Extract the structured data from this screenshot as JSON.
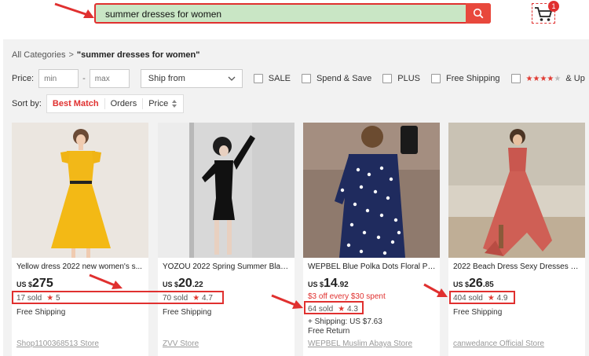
{
  "search": {
    "query": "summer dresses for women"
  },
  "cart": {
    "count": "1"
  },
  "breadcrumb": {
    "root": "All Categories",
    "separator": ">",
    "query": "\"summer dresses for women\""
  },
  "filters": {
    "price_label": "Price:",
    "min_placeholder": "min",
    "max_placeholder": "max",
    "dash": "-",
    "ship_from": "Ship from",
    "checkboxes": [
      "SALE",
      "Spend & Save",
      "PLUS",
      "Free Shipping"
    ],
    "rating_up": "& Up"
  },
  "sort": {
    "label": "Sort by:",
    "options": [
      "Best Match",
      "Orders",
      "Price"
    ]
  },
  "products": [
    {
      "title": "Yellow dress 2022 new women's s...",
      "currency": "US $",
      "price_whole": "275",
      "price_cents": "",
      "sold": "17 sold",
      "rating": "5",
      "shipping": "Free Shipping",
      "store": "Shop1100368513 Store"
    },
    {
      "title": "YOZOU 2022 Spring Summer Black...",
      "currency": "US $",
      "price_whole": "20",
      "price_cents": ".22",
      "sold": "70 sold",
      "rating": "4.7",
      "shipping": "Free Shipping",
      "store": "ZVV Store"
    },
    {
      "title": "WEPBEL Blue Polka Dots Floral Pri...",
      "currency": "US $",
      "price_whole": "14",
      "price_cents": ".92",
      "promo": "$3 off every $30 spent",
      "sold": "64 sold",
      "rating": "4.3",
      "shipping": "+ Shipping: US $7.63",
      "extra": "Free Return",
      "store": "WEPBEL Muslim Abaya Store"
    },
    {
      "title": "2022 Beach Dress Sexy Dresses Bo...",
      "currency": "US $",
      "price_whole": "26",
      "price_cents": ".85",
      "sold": "404 sold",
      "rating": "4.9",
      "shipping": "Free Shipping",
      "store": "canwedance Official Store"
    }
  ],
  "colors": {
    "accent": "#e0302f",
    "search_highlight": "#c9e6c5"
  }
}
